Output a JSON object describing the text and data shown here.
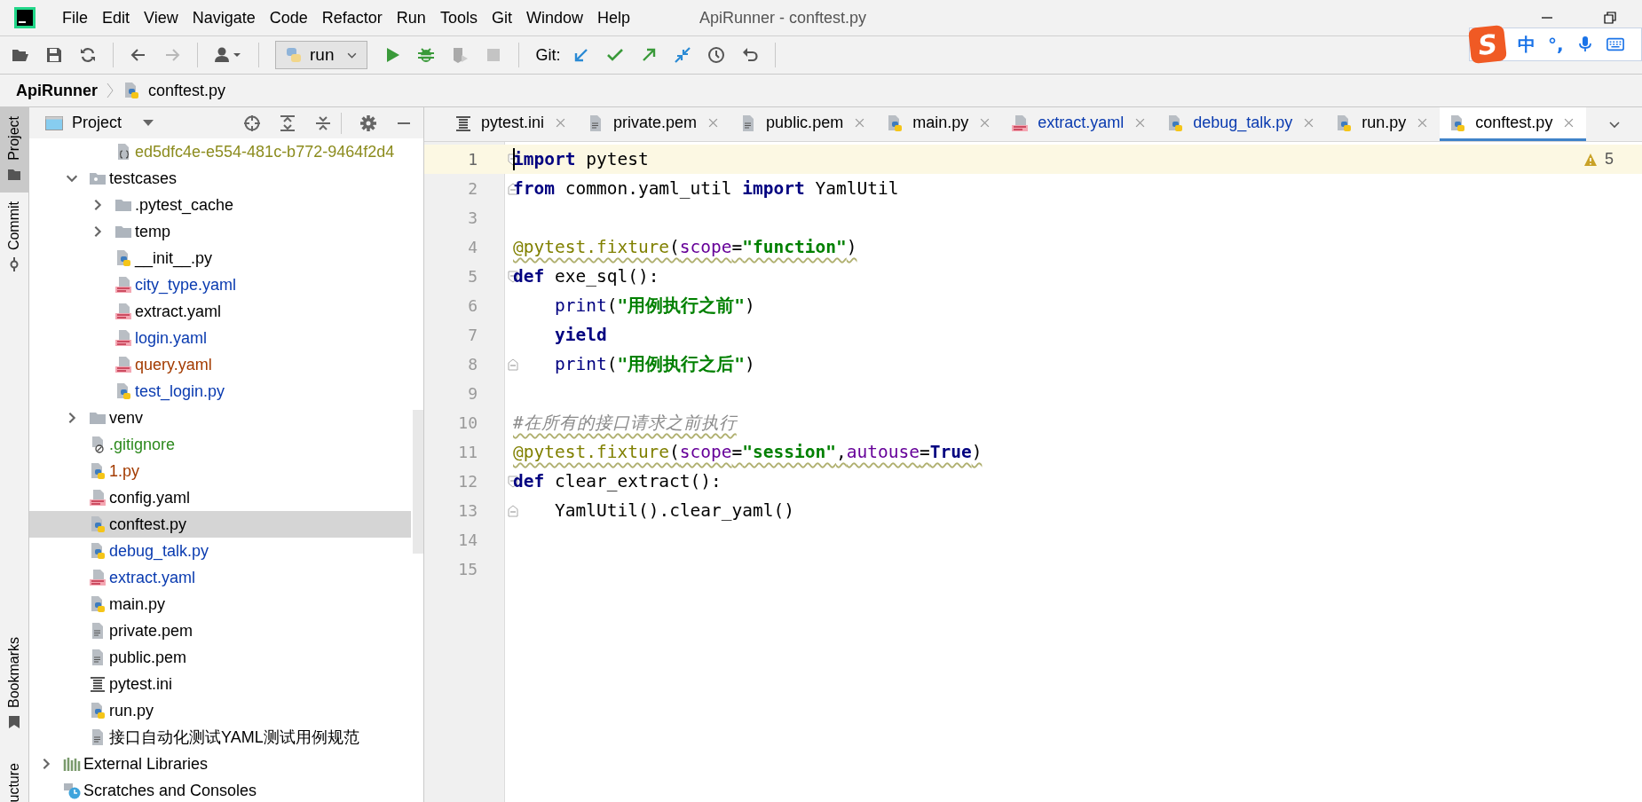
{
  "window": {
    "title": "ApiRunner - conftest.py"
  },
  "menu": [
    "File",
    "Edit",
    "View",
    "Navigate",
    "Code",
    "Refactor",
    "Run",
    "Tools",
    "Git",
    "Window",
    "Help"
  ],
  "toolbar": {
    "run_config": "run",
    "git_label": "Git:",
    "forward_disabled": true,
    "coverage_disabled": true,
    "stop_disabled": true
  },
  "ime": {
    "logo": "S",
    "mode": "中",
    "punctuation": "°,"
  },
  "breadcrumb": {
    "project": "ApiRunner",
    "file": "conftest.py"
  },
  "tool_strip": [
    {
      "label": "Project",
      "selected": true,
      "kind": "folder"
    },
    {
      "label": "Commit",
      "selected": false,
      "kind": "commit"
    },
    {
      "label": "Bookmarks",
      "selected": false,
      "kind": "bookmark"
    },
    {
      "label": "ucture",
      "selected": false,
      "kind": "plain"
    }
  ],
  "project_panel": {
    "title": "Project",
    "continued_children": [
      {
        "label": "ed5dfc4e-e554-481c-b772-9464f2d4",
        "kind": "json",
        "color": "#8c8c1e",
        "selected": false
      }
    ],
    "items": [
      {
        "label": "testcases",
        "kind": "package",
        "color": "#000000",
        "selected": false,
        "expanded": true,
        "children": [
          {
            "label": ".pytest_cache",
            "kind": "folder",
            "color": "#000000",
            "selected": false,
            "expanded": false
          },
          {
            "label": "temp",
            "kind": "folder",
            "color": "#000000",
            "selected": false,
            "expanded": false
          },
          {
            "label": "__init__.py",
            "kind": "python",
            "color": "#000000",
            "selected": false
          },
          {
            "label": "city_type.yaml",
            "kind": "yaml",
            "color": "#0a3bb0",
            "selected": false
          },
          {
            "label": "extract.yaml",
            "kind": "yaml",
            "color": "#000000",
            "selected": false
          },
          {
            "label": "login.yaml",
            "kind": "yaml",
            "color": "#0a3bb0",
            "selected": false
          },
          {
            "label": "query.yaml",
            "kind": "yaml",
            "color": "#a33b00",
            "selected": false
          },
          {
            "label": "test_login.py",
            "kind": "python",
            "color": "#0a3bb0",
            "selected": false
          }
        ]
      },
      {
        "label": "venv",
        "kind": "folder",
        "color": "#000000",
        "selected": false,
        "expanded": false
      },
      {
        "label": ".gitignore",
        "kind": "ignore",
        "color": "#2d8a1e",
        "selected": false
      },
      {
        "label": "1.py",
        "kind": "python",
        "color": "#a33b00",
        "selected": false
      },
      {
        "label": "config.yaml",
        "kind": "yaml",
        "color": "#000000",
        "selected": false
      },
      {
        "label": "conftest.py",
        "kind": "python",
        "color": "#000000",
        "selected": true
      },
      {
        "label": "debug_talk.py",
        "kind": "python",
        "color": "#0a3bb0",
        "selected": false
      },
      {
        "label": "extract.yaml",
        "kind": "yaml",
        "color": "#0a3bb0",
        "selected": false
      },
      {
        "label": "main.py",
        "kind": "python",
        "color": "#000000",
        "selected": false
      },
      {
        "label": "private.pem",
        "kind": "text",
        "color": "#000000",
        "selected": false
      },
      {
        "label": "public.pem",
        "kind": "text",
        "color": "#000000",
        "selected": false
      },
      {
        "label": "pytest.ini",
        "kind": "ini",
        "color": "#000000",
        "selected": false
      },
      {
        "label": "run.py",
        "kind": "python",
        "color": "#000000",
        "selected": false
      },
      {
        "label": "接口自动化测试YAML测试用例规范",
        "kind": "text",
        "color": "#000000",
        "selected": false
      }
    ],
    "roots": [
      {
        "label": "External Libraries",
        "kind": "library",
        "color": "#000000",
        "selected": false,
        "expanded": false
      },
      {
        "label": "Scratches and Consoles",
        "kind": "scratches",
        "color": "#000000",
        "selected": false
      }
    ]
  },
  "tabs": [
    {
      "label": "pytest.ini",
      "kind": "ini",
      "color": "#000000",
      "selected": false
    },
    {
      "label": "private.pem",
      "kind": "text",
      "color": "#000000",
      "selected": false
    },
    {
      "label": "public.pem",
      "kind": "text",
      "color": "#000000",
      "selected": false
    },
    {
      "label": "main.py",
      "kind": "python",
      "color": "#000000",
      "selected": false
    },
    {
      "label": "extract.yaml",
      "kind": "yaml",
      "color": "#0a3bb0",
      "selected": false
    },
    {
      "label": "debug_talk.py",
      "kind": "python",
      "color": "#0a3bb0",
      "selected": false
    },
    {
      "label": "run.py",
      "kind": "python",
      "color": "#000000",
      "selected": false
    },
    {
      "label": "conftest.py",
      "kind": "python",
      "color": "#000000",
      "selected": true
    }
  ],
  "editor": {
    "warnings": "5",
    "lines": [
      {
        "number": "1",
        "current": true,
        "kind": "fold_start",
        "indented": false,
        "flagged": false,
        "tokens": [
          {
            "kind": "keyword",
            "text": "import"
          },
          {
            "kind": "plain",
            "text": " pytest"
          }
        ]
      },
      {
        "number": "2",
        "current": false,
        "kind": "fold_end",
        "indented": false,
        "flagged": false,
        "tokens": [
          {
            "kind": "keyword",
            "text": "from"
          },
          {
            "kind": "plain",
            "text": " common.yaml_util "
          },
          {
            "kind": "keyword",
            "text": "import"
          },
          {
            "kind": "plain",
            "text": " YamlUtil"
          }
        ]
      },
      {
        "number": "3",
        "current": false,
        "kind": "plain"
      },
      {
        "number": "4",
        "current": false,
        "kind": "plain",
        "indented": false,
        "flagged": true,
        "tokens": [
          {
            "kind": "decorator",
            "text": "@pytest.fixture"
          },
          {
            "kind": "plain",
            "text": "("
          },
          {
            "kind": "param",
            "text": "scope"
          },
          {
            "kind": "plain",
            "text": "="
          },
          {
            "kind": "string",
            "text": "\"function\""
          },
          {
            "kind": "plain",
            "text": ")"
          }
        ]
      },
      {
        "number": "5",
        "current": false,
        "kind": "fold_start",
        "indented": false,
        "flagged": false,
        "tokens": [
          {
            "kind": "keyword",
            "text": "def"
          },
          {
            "kind": "plain",
            "text": " exe_sql():"
          }
        ]
      },
      {
        "number": "6",
        "current": false,
        "kind": "plain",
        "indented": true,
        "flagged": false,
        "tokens": [
          {
            "kind": "builtin",
            "text": "print"
          },
          {
            "kind": "plain",
            "text": "("
          },
          {
            "kind": "string",
            "text": "\"用例执行之前\""
          },
          {
            "kind": "plain",
            "text": ")"
          }
        ]
      },
      {
        "number": "7",
        "current": false,
        "kind": "plain",
        "indented": true,
        "flagged": false,
        "tokens": [
          {
            "kind": "keyword",
            "text": "yield"
          }
        ]
      },
      {
        "number": "8",
        "current": false,
        "kind": "fold_end",
        "indented": true,
        "flagged": false,
        "tokens": [
          {
            "kind": "builtin",
            "text": "print"
          },
          {
            "kind": "plain",
            "text": "("
          },
          {
            "kind": "string",
            "text": "\"用例执行之后\""
          },
          {
            "kind": "plain",
            "text": ")"
          }
        ]
      },
      {
        "number": "9",
        "current": false,
        "kind": "plain"
      },
      {
        "number": "10",
        "current": false,
        "kind": "plain",
        "indented": false,
        "flagged": true,
        "tokens": [
          {
            "kind": "comment",
            "text": "#在所有的接口请求之前执行"
          }
        ]
      },
      {
        "number": "11",
        "current": false,
        "kind": "plain",
        "indented": false,
        "flagged": true,
        "tokens": [
          {
            "kind": "decorator",
            "text": "@pytest.fixture"
          },
          {
            "kind": "plain",
            "text": "("
          },
          {
            "kind": "param",
            "text": "scope"
          },
          {
            "kind": "plain",
            "text": "="
          },
          {
            "kind": "string",
            "text": "\"session\""
          },
          {
            "kind": "plain",
            "text": ","
          },
          {
            "kind": "param",
            "text": "autouse"
          },
          {
            "kind": "plain",
            "text": "="
          },
          {
            "kind": "keyword",
            "text": "True"
          },
          {
            "kind": "plain",
            "text": ")"
          }
        ]
      },
      {
        "number": "12",
        "current": false,
        "kind": "fold_start",
        "indented": false,
        "flagged": false,
        "tokens": [
          {
            "kind": "keyword",
            "text": "def"
          },
          {
            "kind": "plain",
            "text": " clear_extract():"
          }
        ]
      },
      {
        "number": "13",
        "current": false,
        "kind": "fold_end",
        "indented": true,
        "flagged": false,
        "tokens": [
          {
            "kind": "plain",
            "text": "YamlUtil().clear_yaml()"
          }
        ]
      },
      {
        "number": "14",
        "current": false,
        "kind": "plain"
      },
      {
        "number": "15",
        "current": false,
        "kind": "plain"
      }
    ]
  }
}
